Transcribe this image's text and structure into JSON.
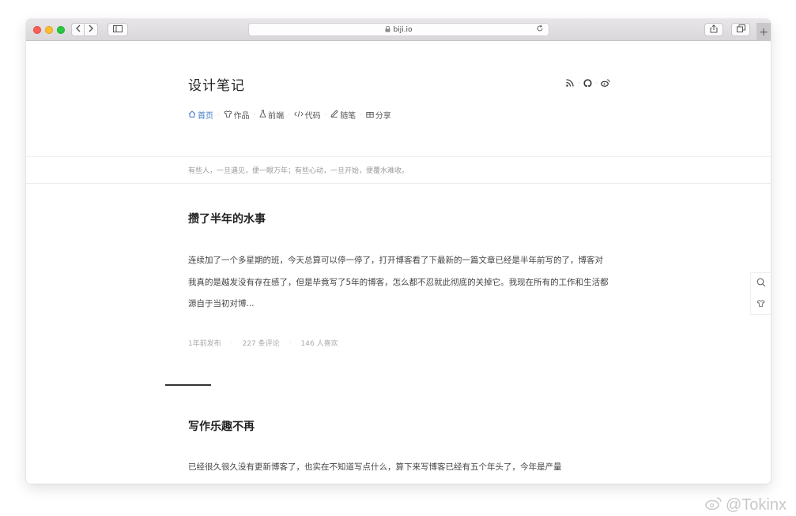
{
  "browser": {
    "url": "biji.io",
    "icons": {
      "back": "chevron-left-icon",
      "forward": "chevron-right-icon",
      "sidebar": "sidebar-icon",
      "lock": "lock-icon",
      "reload": "reload-icon",
      "share": "share-icon",
      "tabs": "tabs-icon",
      "new_tab": "plus-icon"
    }
  },
  "site": {
    "title": "设计笔记",
    "header_icons": [
      "rss-icon",
      "github-icon",
      "weibo-icon"
    ],
    "nav": [
      {
        "label": "首页",
        "icon": "home-icon",
        "active": true
      },
      {
        "label": "作品",
        "icon": "shirt-icon",
        "active": false
      },
      {
        "label": "前端",
        "icon": "flask-icon",
        "active": false
      },
      {
        "label": "代码",
        "icon": "code-icon",
        "active": false
      },
      {
        "label": "随笔",
        "icon": "pen-icon",
        "active": false
      },
      {
        "label": "分享",
        "icon": "gift-icon",
        "active": false
      }
    ],
    "tagline": "有些人，一旦遇见，便一眼万年；有些心动，一旦开始，便覆水难收。"
  },
  "posts": [
    {
      "title": "攒了半年的水事",
      "excerpt": "连续加了一个多星期的班，今天总算可以停一停了，打开博客看了下最新的一篇文章已经是半年前写的了，博客对我真的是越发没有存在感了，但是毕竟写了5年的博客，怎么都不忍就此彻底的关掉它。我现在所有的工作和生活都源自于当初对博...",
      "meta": {
        "published": "1年前发布",
        "comments": "227 条评论",
        "likes": "146 人喜欢"
      }
    },
    {
      "title": "写作乐趣不再",
      "excerpt": "已经很久很久没有更新博客了，也实在不知道写点什么，算下来写博客已经有五个年头了，今年是产量"
    }
  ],
  "side_tools": [
    "search-icon",
    "shirt-icon"
  ],
  "watermark": "@Tokinx",
  "colors": {
    "nav_active": "#3a78c4",
    "traffic_red": "#ff5f57",
    "traffic_yellow": "#febc2e",
    "traffic_green": "#28c840"
  }
}
